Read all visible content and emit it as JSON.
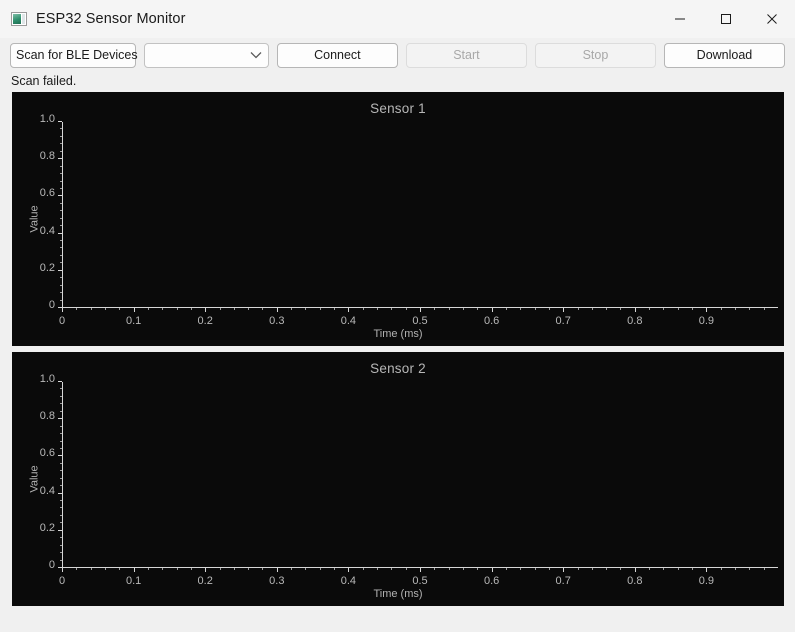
{
  "window": {
    "title": "ESP32 Sensor Monitor",
    "icon": "app-window-icon",
    "controls": {
      "minimize": "minimize-icon",
      "maximize": "maximize-icon",
      "close": "close-icon"
    },
    "background": "#f0f0f0"
  },
  "toolbar": {
    "scan_label": "Scan for BLE Devices",
    "device_select": {
      "value": "",
      "placeholder": "",
      "arrow": "chevron-down-icon"
    },
    "connect_label": "Connect",
    "start_label": "Start",
    "start_enabled": false,
    "stop_label": "Stop",
    "stop_enabled": false,
    "download_label": "Download"
  },
  "status": {
    "text": "Scan failed."
  },
  "chart_data": [
    {
      "type": "line",
      "title": "Sensor 1",
      "xlabel": "Time (ms)",
      "ylabel": "Value",
      "x": [],
      "values": [],
      "series": [],
      "xlim": [
        0,
        1
      ],
      "ylim": [
        0,
        1
      ],
      "xticks": [
        "0",
        "0.1",
        "0.2",
        "0.3",
        "0.4",
        "0.5",
        "0.6",
        "0.7",
        "0.8",
        "0.9"
      ],
      "xtick_values": [
        0,
        0.1,
        0.2,
        0.3,
        0.4,
        0.5,
        0.6,
        0.7,
        0.8,
        0.9
      ],
      "yticks": [
        "0",
        "0.2",
        "0.4",
        "0.6",
        "0.8",
        "1.0"
      ],
      "ytick_values": [
        0,
        0.2,
        0.4,
        0.6,
        0.8,
        1.0
      ],
      "grid": false,
      "legend": null,
      "background": "#0a0a0a",
      "foreground": "#b9b9b9"
    },
    {
      "type": "line",
      "title": "Sensor 2",
      "xlabel": "Time (ms)",
      "ylabel": "Value",
      "x": [],
      "values": [],
      "series": [],
      "xlim": [
        0,
        1
      ],
      "ylim": [
        0,
        1
      ],
      "xticks": [
        "0",
        "0.1",
        "0.2",
        "0.3",
        "0.4",
        "0.5",
        "0.6",
        "0.7",
        "0.8",
        "0.9"
      ],
      "xtick_values": [
        0,
        0.1,
        0.2,
        0.3,
        0.4,
        0.5,
        0.6,
        0.7,
        0.8,
        0.9
      ],
      "yticks": [
        "0",
        "0.2",
        "0.4",
        "0.6",
        "0.8",
        "1.0"
      ],
      "ytick_values": [
        0,
        0.2,
        0.4,
        0.6,
        0.8,
        1.0
      ],
      "grid": false,
      "legend": null,
      "background": "#0a0a0a",
      "foreground": "#b9b9b9"
    }
  ]
}
